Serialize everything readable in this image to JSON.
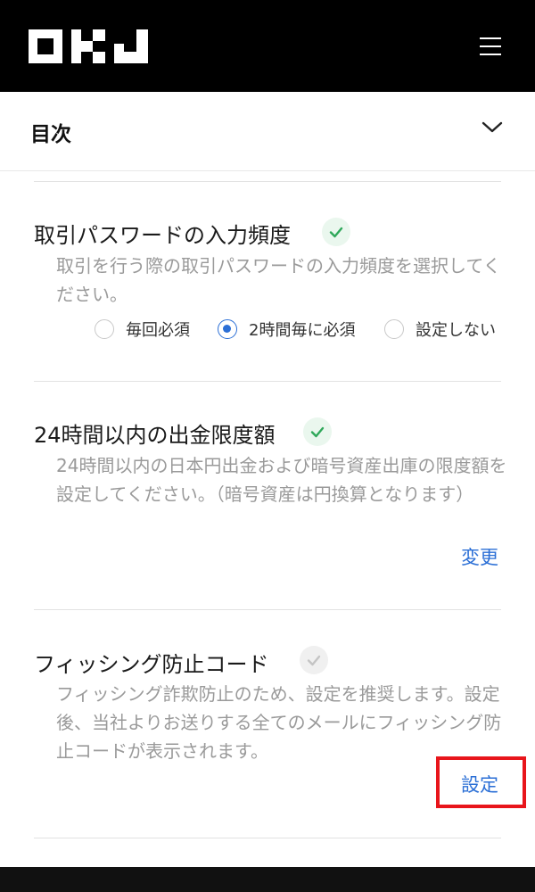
{
  "header": {
    "logo_icon": "okj-logo-icon",
    "menu_icon": "hamburger-menu-icon"
  },
  "toc": {
    "title": "目次",
    "toggle_icon": "chevron-down-icon"
  },
  "sections": [
    {
      "title": "取引パスワードの入力頻度",
      "status": "set",
      "status_icon": "check-circle-icon",
      "description": "取引を行う際の取引パスワードの入力頻度を選択してください。",
      "options": [
        {
          "label": "毎回必須",
          "selected": false
        },
        {
          "label": "2時間毎に必須",
          "selected": true
        },
        {
          "label": "設定しない",
          "selected": false
        }
      ]
    },
    {
      "title": "24時間以内の出金限度額",
      "status": "set",
      "status_icon": "check-circle-icon",
      "description": "24時間以内の日本円出金および暗号資産出庫の限度額を設定してください。（暗号資産は円換算となります）",
      "action_label": "変更"
    },
    {
      "title": "フィッシング防止コード",
      "status": "not-set",
      "status_icon": "check-circle-icon",
      "description": "フィッシング詐欺防止のため、設定を推奨します。設定後、当社よりお送りする全てのメールにフィッシング防止コードが表示されます。",
      "action_label": "設定"
    }
  ],
  "colors": {
    "accent": "#2b6fd6",
    "check_set": "#2fa85a",
    "check_unset": "#c4c4c4",
    "highlight": "#e8151b"
  }
}
